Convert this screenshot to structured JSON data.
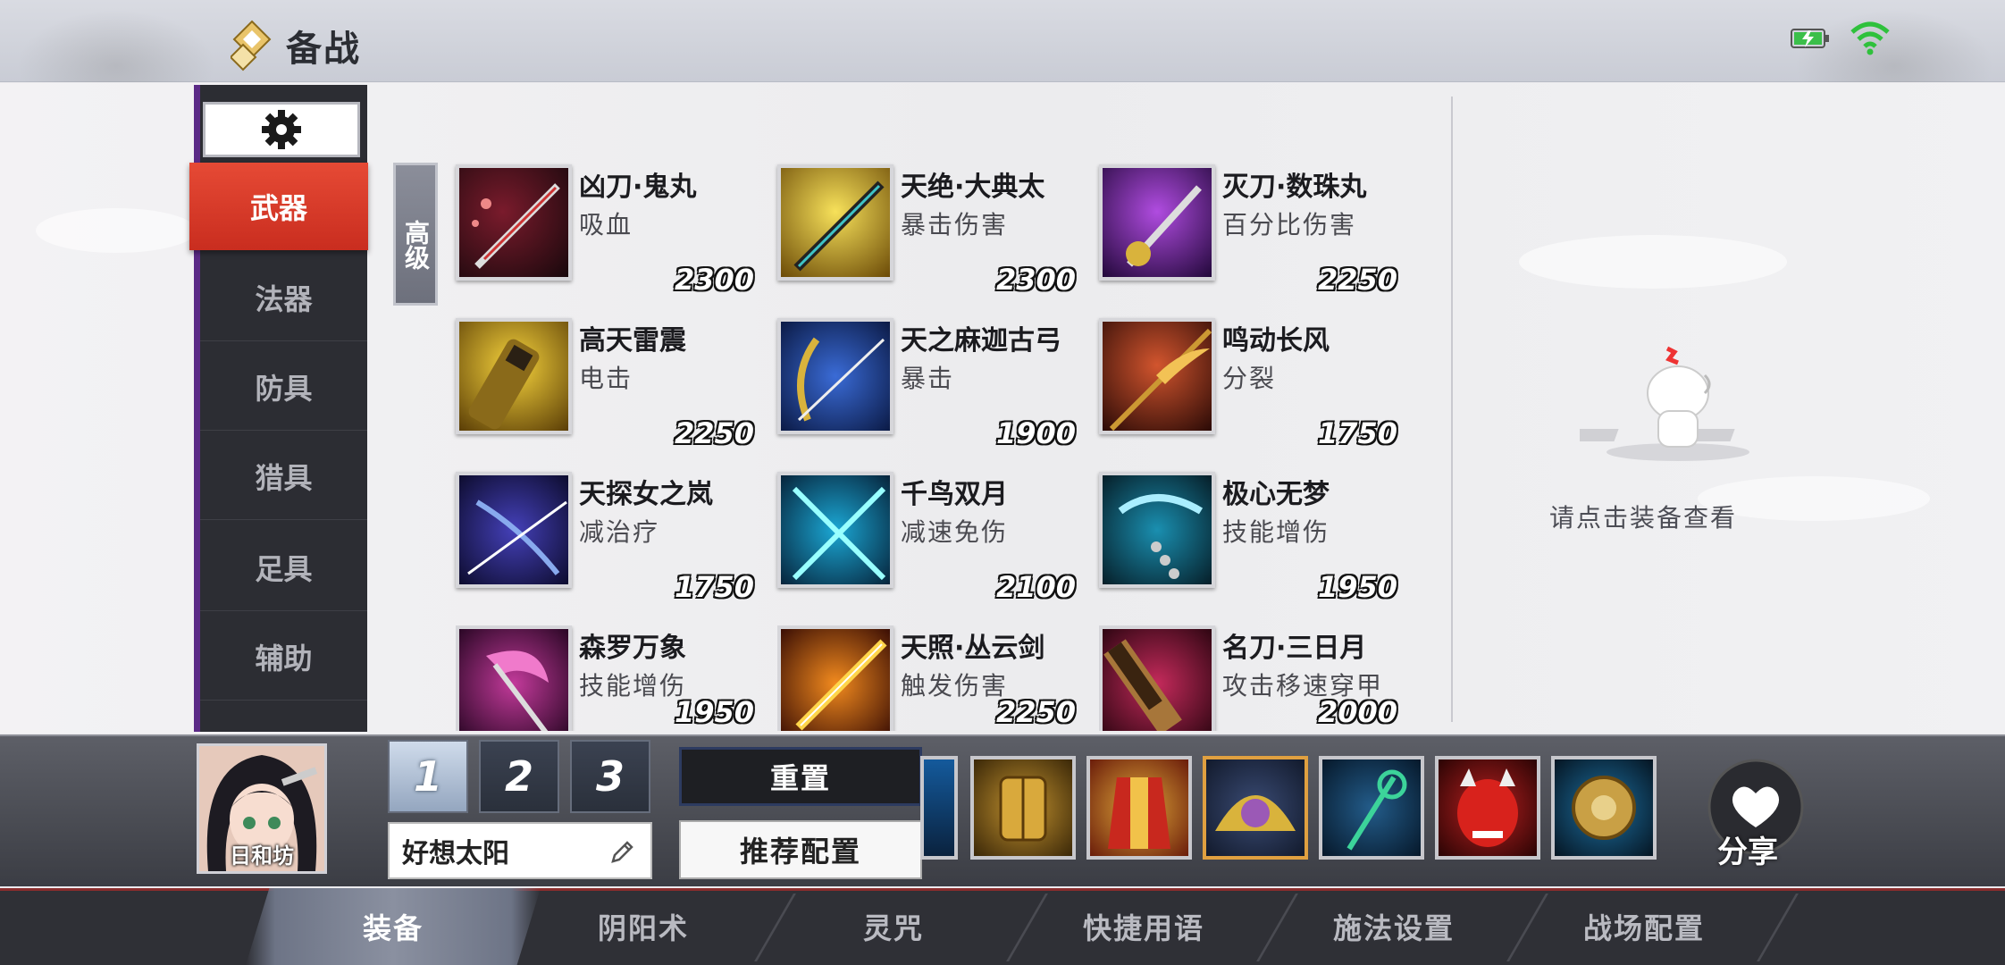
{
  "header": {
    "title": "备战",
    "icons": {
      "logo": "diamond-logo-icon",
      "battery": "battery-icon",
      "wifi": "wifi-icon"
    }
  },
  "sidebar": {
    "settings_icon": "gear-icon",
    "categories": [
      {
        "label": "武器",
        "active": true
      },
      {
        "label": "法器",
        "active": false
      },
      {
        "label": "防具",
        "active": false
      },
      {
        "label": "猎具",
        "active": false
      },
      {
        "label": "足具",
        "active": false
      },
      {
        "label": "辅助",
        "active": false
      }
    ]
  },
  "tier_label": "高级",
  "items": [
    {
      "name": "凶刀·鬼丸",
      "effect": "吸血",
      "price": "2300"
    },
    {
      "name": "天绝·大典太",
      "effect": "暴击伤害",
      "price": "2300"
    },
    {
      "name": "灭刀·数珠丸",
      "effect": "百分比伤害",
      "price": "2250"
    },
    {
      "name": "高天雷震",
      "effect": "电击",
      "price": "2250"
    },
    {
      "name": "天之麻迦古弓",
      "effect": "暴击",
      "price": "1900"
    },
    {
      "name": "鸣动长风",
      "effect": "分裂",
      "price": "1750"
    },
    {
      "name": "天探女之岚",
      "effect": "减治疗",
      "price": "1750"
    },
    {
      "name": "千鸟双月",
      "effect": "减速免伤",
      "price": "2100"
    },
    {
      "name": "极心无梦",
      "effect": "技能增伤",
      "price": "1950"
    },
    {
      "name": "森罗万象",
      "effect": "技能增伤",
      "price": "1950"
    },
    {
      "name": "天照·丛云剑",
      "effect": "触发伤害",
      "price": "2250"
    },
    {
      "name": "名刀·三日月",
      "effect": "攻击移速穿甲",
      "price": "2000"
    }
  ],
  "detail_panel": {
    "hint": "请点击装备查看"
  },
  "loadout": {
    "hero_name": "日和坊",
    "slots": [
      {
        "label": "1",
        "active": true
      },
      {
        "label": "2",
        "active": false
      },
      {
        "label": "3",
        "active": false
      }
    ],
    "plan_name": "好想太阳",
    "reset_label": "重置",
    "recommend_label": "推荐配置",
    "share_label": "分享",
    "equipped": [
      "blue-weapon-icon",
      "gold-armor-icon",
      "red-robe-icon",
      "mask-fan-icon",
      "green-staff-icon",
      "oni-mask-icon",
      "gold-disc-icon"
    ]
  },
  "tabs": [
    {
      "label": "装备",
      "active": true
    },
    {
      "label": "阴阳术",
      "active": false
    },
    {
      "label": "灵咒",
      "active": false
    },
    {
      "label": "快捷用语",
      "active": false
    },
    {
      "label": "施法设置",
      "active": false
    },
    {
      "label": "战场配置",
      "active": false
    }
  ]
}
